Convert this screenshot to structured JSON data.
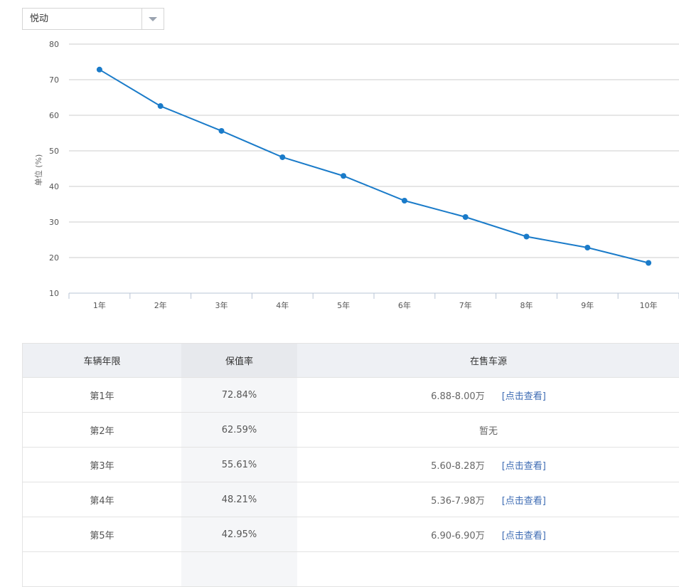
{
  "model_select": {
    "value": "悦动"
  },
  "chart_data": {
    "type": "line",
    "ylabel": "单位 (%)",
    "ylim": [
      10,
      80
    ],
    "yticks": [
      80,
      70,
      60,
      50,
      40,
      30,
      20,
      10
    ],
    "categories": [
      "1年",
      "2年",
      "3年",
      "4年",
      "5年",
      "6年",
      "7年",
      "8年",
      "9年",
      "10年"
    ],
    "series": [
      {
        "values": [
          72.84,
          62.59,
          55.61,
          48.21,
          42.95,
          36.0,
          31.4,
          25.9,
          22.8,
          18.5
        ]
      }
    ],
    "grid": true,
    "line_color": "#1a7bc9"
  },
  "table": {
    "headers": [
      "车辆年限",
      "保值率",
      "在售车源"
    ],
    "rows": [
      {
        "year": "第1年",
        "rate": "72.84%",
        "price": "6.88-8.00万",
        "link": "[点击查看]"
      },
      {
        "year": "第2年",
        "rate": "62.59%",
        "price": "暂无",
        "link": ""
      },
      {
        "year": "第3年",
        "rate": "55.61%",
        "price": "5.60-8.28万",
        "link": "[点击查看]"
      },
      {
        "year": "第4年",
        "rate": "48.21%",
        "price": "5.36-7.98万",
        "link": "[点击查看]"
      },
      {
        "year": "第5年",
        "rate": "42.95%",
        "price": "6.90-6.90万",
        "link": "[点击查看]"
      }
    ]
  }
}
